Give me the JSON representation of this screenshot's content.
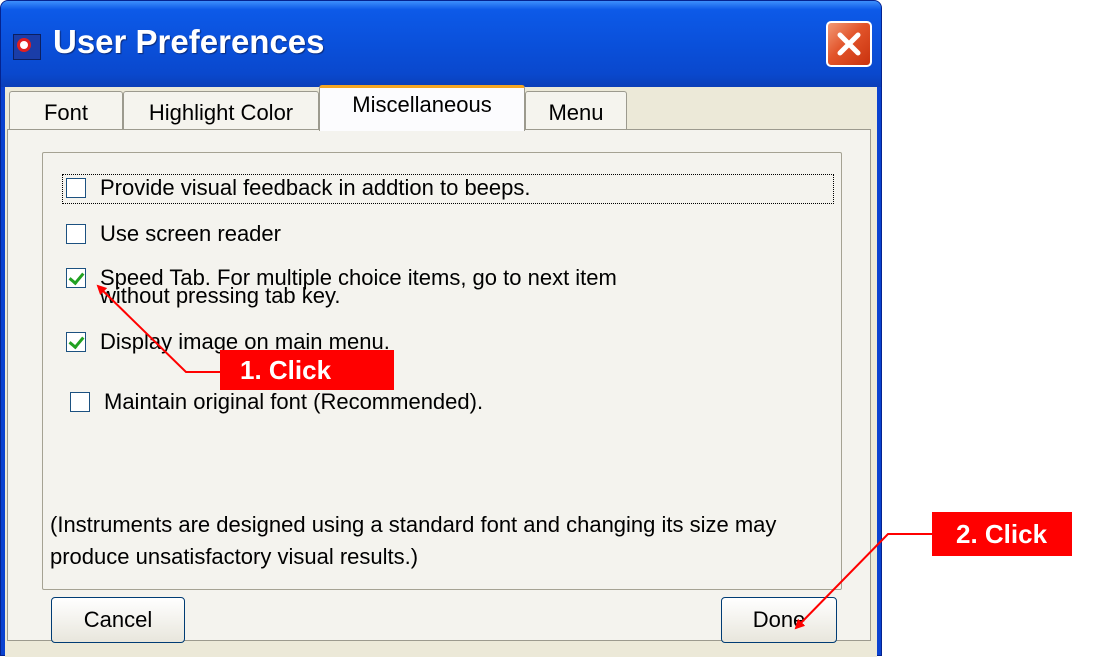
{
  "window": {
    "title": "User Preferences"
  },
  "tabs": [
    {
      "label": "Font"
    },
    {
      "label": "Highlight Color"
    },
    {
      "label": "Miscellaneous",
      "active": true
    },
    {
      "label": "Menu"
    }
  ],
  "options": [
    {
      "label": "Provide visual feedback in addtion to beeps.",
      "checked": false
    },
    {
      "label": "Use screen reader",
      "checked": false
    },
    {
      "label": "Speed Tab. For multiple choice items, go to next item",
      "label_line2": "without pressing tab key.",
      "checked": true
    },
    {
      "label": "Display image on main menu.",
      "checked": true
    },
    {
      "label": "Maintain original font (Recommended).",
      "checked": false
    }
  ],
  "note": "(Instruments are designed using a standard font and changing its size may produce unsatisfactory visual results.)",
  "buttons": {
    "cancel": "Cancel",
    "done": "Done"
  },
  "annotations": {
    "step1": "1. Click",
    "step2": "2. Click",
    "color": "#ff0000"
  },
  "icons": {
    "app": "app-icon",
    "close": "close-icon"
  }
}
